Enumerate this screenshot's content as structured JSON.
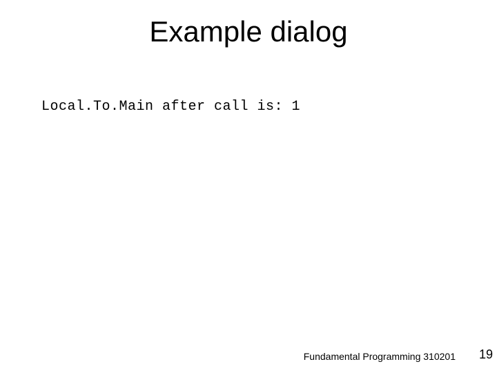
{
  "slide": {
    "title": "Example dialog",
    "body": "Local.To.Main after call is: 1",
    "footer_text": "Fundamental Programming 310201",
    "page_number": "19"
  }
}
